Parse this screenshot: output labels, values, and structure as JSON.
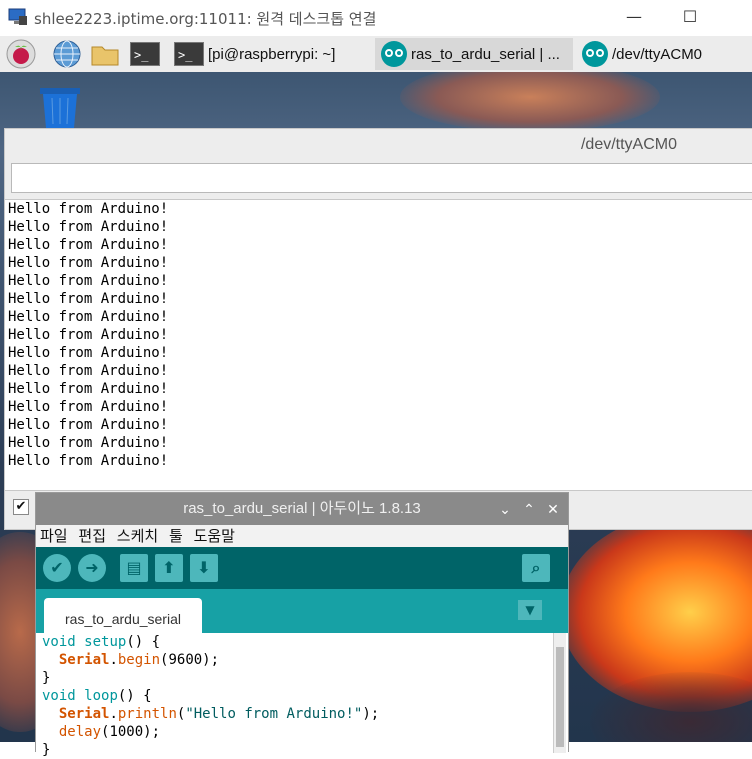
{
  "rdp": {
    "title": "shlee2223.iptime.org:11011: 원격 데스크톱 연결",
    "minimize": "—",
    "maximize": "☐"
  },
  "taskbar": {
    "tasks": [
      {
        "label": "[pi@raspberrypi: ~]"
      },
      {
        "label": "ras_to_ardu_serial | ..."
      },
      {
        "label": "/dev/ttyACM0"
      }
    ]
  },
  "serial_monitor": {
    "title": "/dev/ttyACM0",
    "input_value": "",
    "lines": [
      "Hello from Arduino!",
      "Hello from Arduino!",
      "Hello from Arduino!",
      "Hello from Arduino!",
      "Hello from Arduino!",
      "Hello from Arduino!",
      "Hello from Arduino!",
      "Hello from Arduino!",
      "Hello from Arduino!",
      "Hello from Arduino!",
      "Hello from Arduino!",
      "Hello from Arduino!",
      "Hello from Arduino!",
      "Hello from Arduino!",
      "Hello from Arduino!"
    ],
    "autoscroll_checked": "✔"
  },
  "ide": {
    "title": "ras_to_ardu_serial | 아두이노 1.8.13",
    "controls": [
      "⌄",
      "⌃",
      "✕"
    ],
    "menu": [
      "파일",
      "편집",
      "스케치",
      "툴",
      "도움말"
    ],
    "tab_label": "ras_to_ardu_serial",
    "code": [
      {
        "parts": [
          {
            "t": "void",
            "c": "kw"
          },
          {
            "t": " "
          },
          {
            "t": "setup",
            "c": "kw"
          },
          {
            "t": "() {"
          }
        ]
      },
      {
        "parts": [
          {
            "t": "  "
          },
          {
            "t": "Serial",
            "c": "fn"
          },
          {
            "t": "."
          },
          {
            "t": "begin",
            "c": "fn2"
          },
          {
            "t": "(9600);"
          }
        ]
      },
      {
        "parts": [
          {
            "t": "}"
          }
        ]
      },
      {
        "parts": [
          {
            "t": "void",
            "c": "kw"
          },
          {
            "t": " "
          },
          {
            "t": "loop",
            "c": "kw"
          },
          {
            "t": "() {"
          }
        ]
      },
      {
        "parts": [
          {
            "t": "  "
          },
          {
            "t": "Serial",
            "c": "fn"
          },
          {
            "t": "."
          },
          {
            "t": "println",
            "c": "fn2"
          },
          {
            "t": "("
          },
          {
            "t": "\"Hello from Arduino!\"",
            "c": "str"
          },
          {
            "t": ");"
          }
        ]
      },
      {
        "parts": [
          {
            "t": "  "
          },
          {
            "t": "delay",
            "c": "fn2"
          },
          {
            "t": "(1000);"
          }
        ]
      },
      {
        "parts": [
          {
            "t": "}"
          }
        ]
      }
    ]
  }
}
